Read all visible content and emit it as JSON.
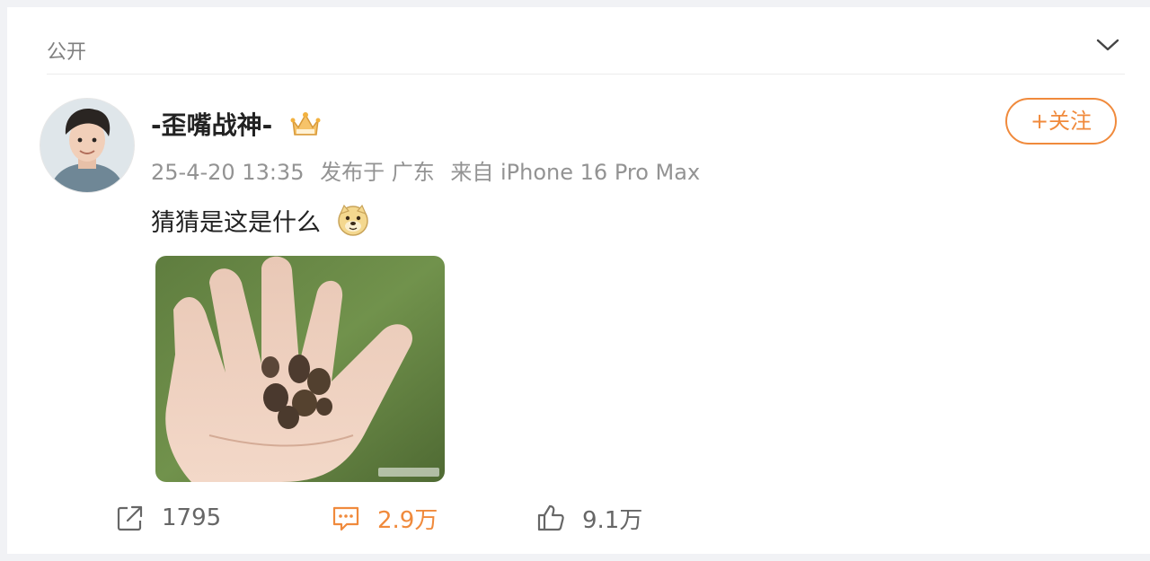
{
  "visibility": {
    "label": "公开"
  },
  "post": {
    "username": "-歪嘴战神-",
    "timestamp": "25-4-20 13:35",
    "location": "发布于 广东",
    "source": "来自 iPhone 16 Pro Max",
    "follow_label": "+关注",
    "text": "猜猜是这是什么",
    "emoji": "doge-emoji"
  },
  "actions": {
    "share_count": "1795",
    "comment_count": "2.9万",
    "like_count": "9.1万"
  },
  "colors": {
    "accent": "#f08a3c",
    "muted_text": "#939393",
    "page_bg": "#f1f2f5"
  }
}
